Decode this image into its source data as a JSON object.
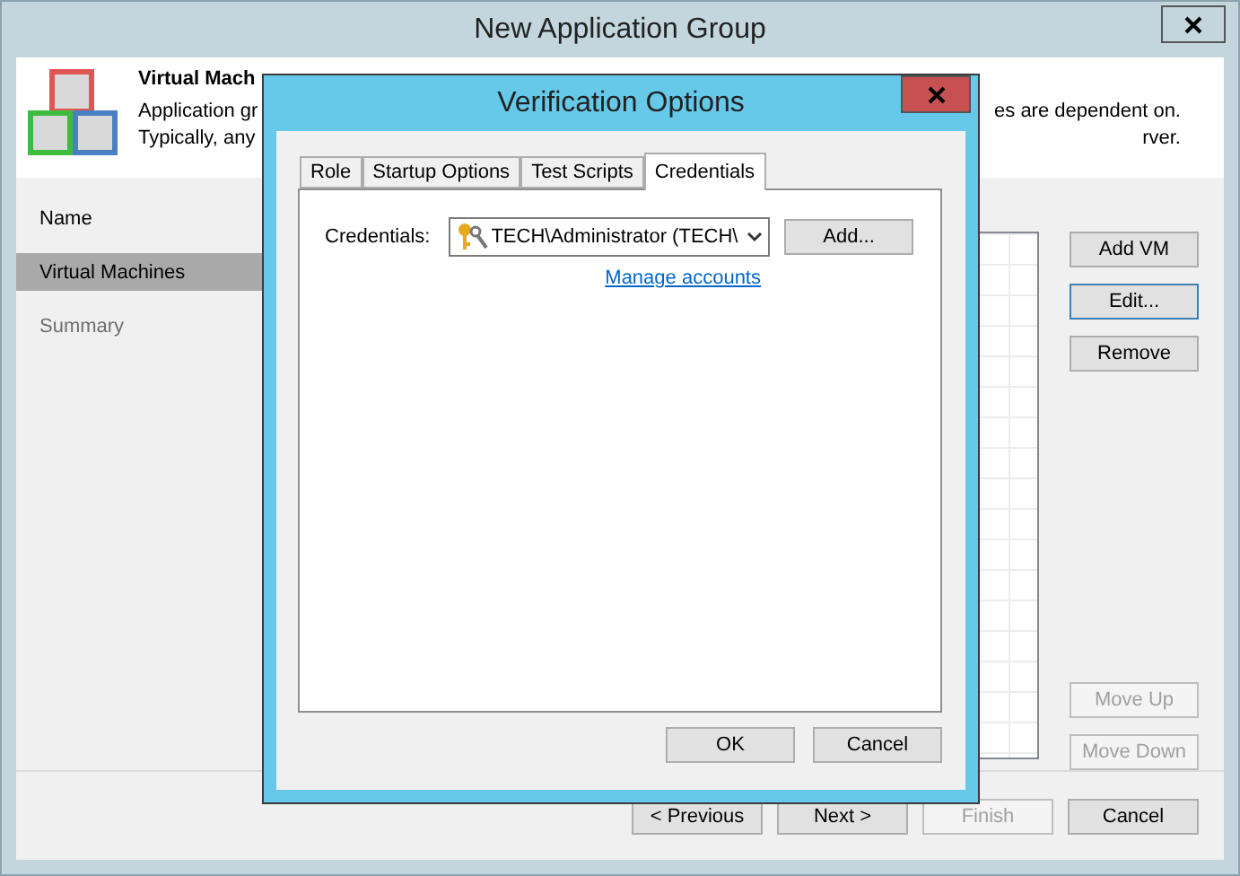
{
  "window": {
    "title": "New Application Group"
  },
  "header": {
    "title": "Virtual Mach",
    "lines_left": [
      "Application gr",
      "Typically, any"
    ],
    "lines_right": [
      "es are dependent on.",
      "rver."
    ]
  },
  "sidebar": {
    "items": [
      {
        "label": "Name",
        "selected": false,
        "disabled": false
      },
      {
        "label": "Virtual Machines",
        "selected": true,
        "disabled": false
      },
      {
        "label": "Summary",
        "selected": false,
        "disabled": true
      }
    ]
  },
  "side_buttons": [
    {
      "label": "Add VM",
      "disabled": false,
      "focused": false
    },
    {
      "label": "Edit...",
      "disabled": false,
      "focused": true
    },
    {
      "label": "Remove",
      "disabled": false,
      "focused": false
    }
  ],
  "order_buttons": [
    {
      "label": "Move Up",
      "disabled": true
    },
    {
      "label": "Move Down",
      "disabled": true
    }
  ],
  "footer_buttons": [
    {
      "label": "< Previous",
      "disabled": false
    },
    {
      "label": "Next >",
      "disabled": false
    },
    {
      "label": "Finish",
      "disabled": true
    },
    {
      "label": "Cancel",
      "disabled": false
    }
  ],
  "dialog": {
    "title": "Verification Options",
    "tabs": [
      {
        "label": "Role",
        "selected": false
      },
      {
        "label": "Startup Options",
        "selected": false
      },
      {
        "label": "Test Scripts",
        "selected": false
      },
      {
        "label": "Credentials",
        "selected": true
      }
    ],
    "credentials_label": "Credentials:",
    "credentials_value": "TECH\\Administrator (TECH\\",
    "add_button": "Add...",
    "link": "Manage accounts",
    "buttons": [
      "OK",
      "Cancel"
    ]
  }
}
